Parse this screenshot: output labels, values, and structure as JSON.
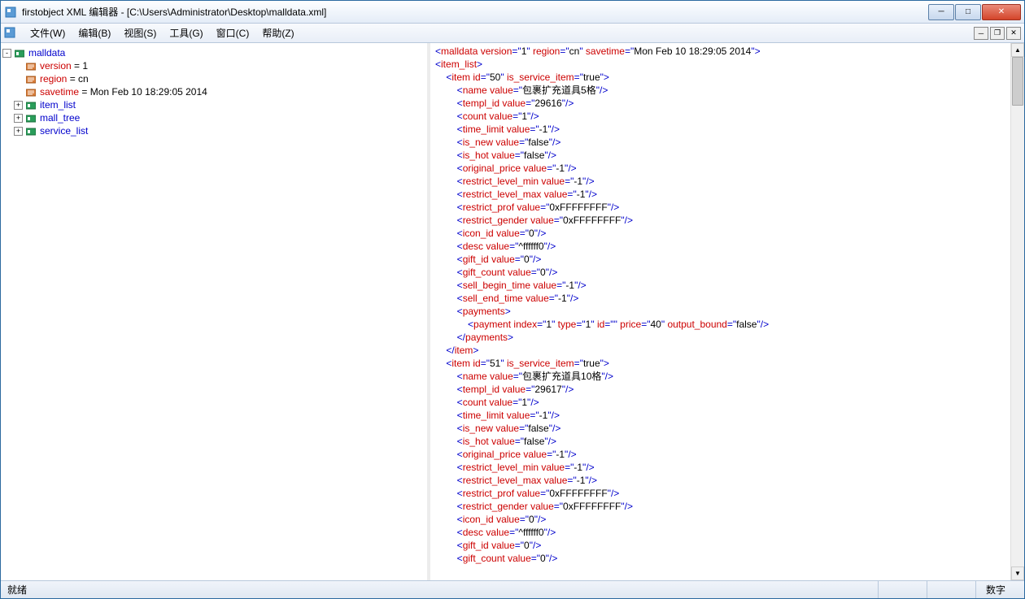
{
  "title": "firstobject XML 编辑器 - [C:\\Users\\Administrator\\Desktop\\malldata.xml]",
  "menu": {
    "file": "文件(W)",
    "edit": "编辑(B)",
    "view": "视图(S)",
    "tools": "工具(G)",
    "window": "窗口(C)",
    "help": "帮助(Z)"
  },
  "tree": {
    "root": "malldata",
    "attrs": [
      {
        "name": "version",
        "value": "1"
      },
      {
        "name": "region",
        "value": "cn"
      },
      {
        "name": "savetime",
        "value": "Mon Feb 10 18:29:05 2014"
      }
    ],
    "children": [
      "item_list",
      "mall_tree",
      "service_list"
    ]
  },
  "xml": {
    "root_open": {
      "tag": "malldata",
      "attrs": [
        {
          "n": "version",
          "v": "1"
        },
        {
          "n": "region",
          "v": "cn"
        },
        {
          "n": "savetime",
          "v": "Mon Feb 10 18:29:05 2014"
        }
      ]
    },
    "item_list_tag": "item_list",
    "items": [
      {
        "id": "50",
        "is_service_item": "true",
        "name": "包裹扩充道具5格",
        "templ_id": "29616",
        "count": "1",
        "time_limit": "-1",
        "is_new": "false",
        "is_hot": "false",
        "original_price": "-1",
        "restrict_level_min": "-1",
        "restrict_level_max": "-1",
        "restrict_prof": "0xFFFFFFFF",
        "restrict_gender": "0xFFFFFFFF",
        "icon_id": "0",
        "desc": "^ffffff0",
        "gift_id": "0",
        "gift_count": "0",
        "sell_begin_time": "-1",
        "sell_end_time": "-1",
        "payment": {
          "index": "1",
          "type": "1",
          "id": "",
          "price": "40",
          "output_bound": "false"
        }
      },
      {
        "id": "51",
        "is_service_item": "true",
        "name": "包裹扩充道具10格",
        "templ_id": "29617",
        "count": "1",
        "time_limit": "-1",
        "is_new": "false",
        "is_hot": "false",
        "original_price": "-1",
        "restrict_level_min": "-1",
        "restrict_level_max": "-1",
        "restrict_prof": "0xFFFFFFFF",
        "restrict_gender": "0xFFFFFFFF",
        "icon_id": "0",
        "desc": "^ffffff0",
        "gift_id": "0",
        "gift_count": "0"
      }
    ]
  },
  "status": {
    "ready": "就绪",
    "num": "数字"
  }
}
